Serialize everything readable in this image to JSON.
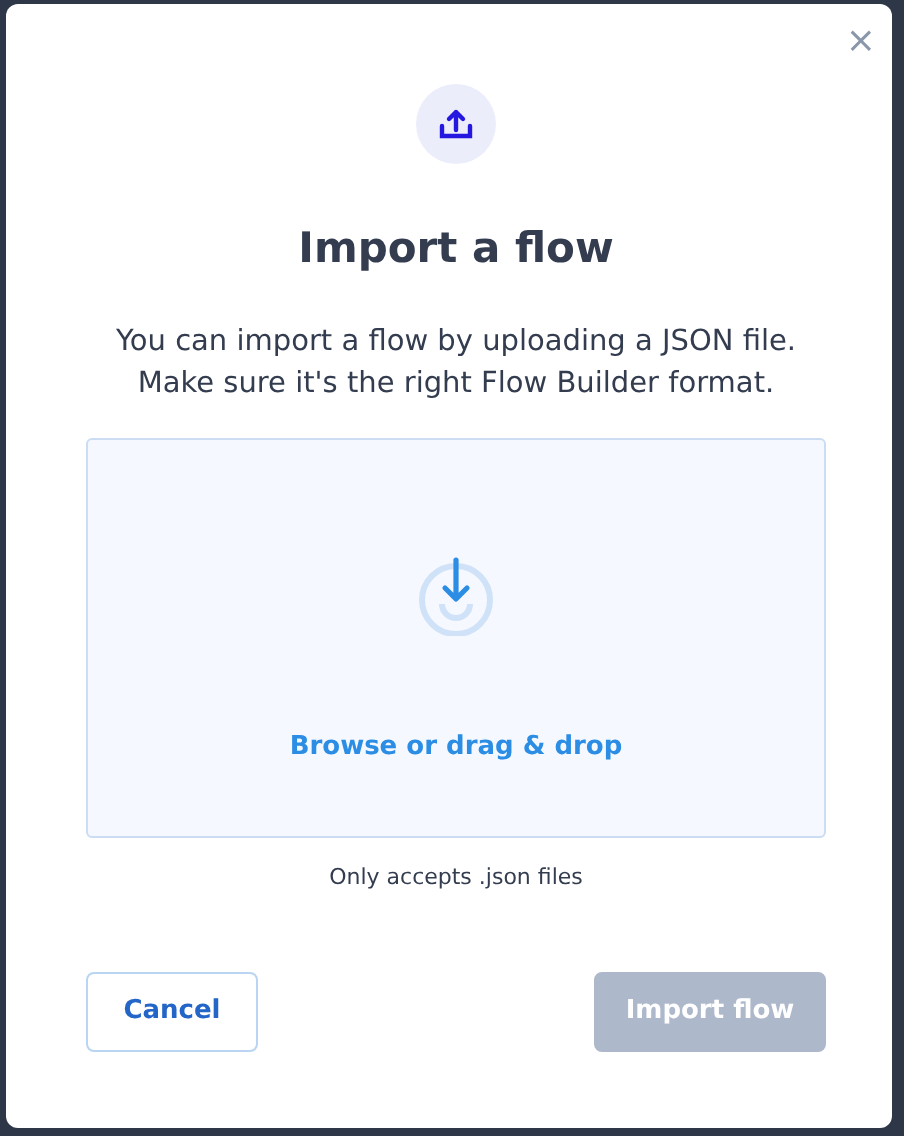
{
  "dialog": {
    "close": "×",
    "title": "Import a flow",
    "description": "You can import a flow by uploading a JSON file. Make sure it's the right Flow Builder format.",
    "dropzone": {
      "action": "Browse or drag & drop"
    },
    "note": "Only accepts .json files",
    "buttons": [
      {
        "label": "Cancel",
        "kind": "secondary",
        "disabled": false
      },
      {
        "label": "Import flow",
        "kind": "primary",
        "disabled": true
      }
    ]
  }
}
